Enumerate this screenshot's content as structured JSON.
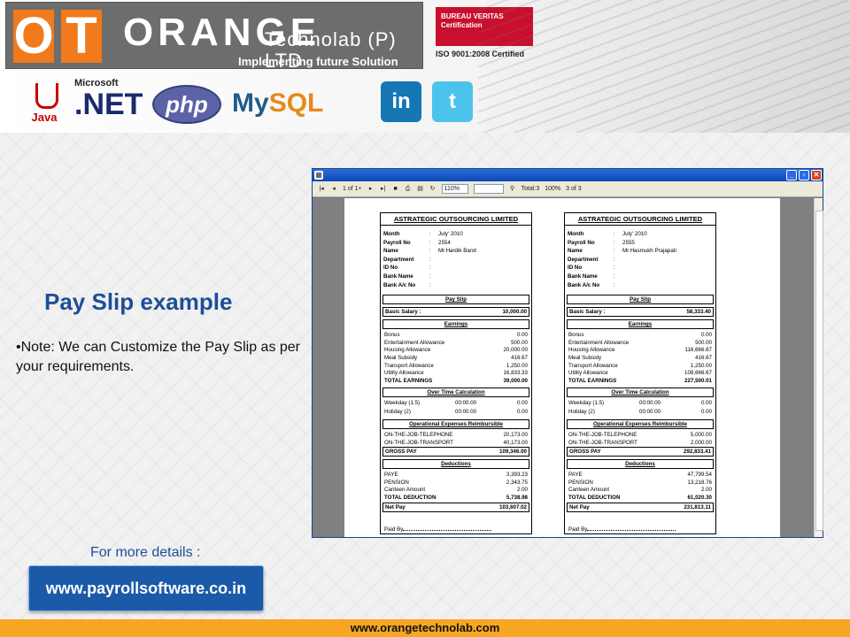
{
  "header": {
    "logo_o": "O",
    "logo_t": "T",
    "brand": "ORANGE",
    "brand_sub": "Technolab (P) LTD",
    "tagline": "Implementing future Solution",
    "cert_logo": "BUREAU VERITAS Certification",
    "cert_text": "ISO 9001:2008 Certified",
    "tech": {
      "java": "Java",
      "microsoft": "Microsoft",
      "net": ".NET",
      "php": "php",
      "mysql_a": "My",
      "mysql_b": "SQL"
    },
    "social": {
      "linkedin": "in",
      "twitter": "t"
    }
  },
  "slide": {
    "title": "Pay Slip example",
    "note": "•Note: We can Customize the Pay Slip as per your requirements.",
    "more_details": "For more details :",
    "url_button": "www.payrollsoftware.co.in",
    "footer": "www.orangetechnolab.com"
  },
  "viewer": {
    "page_of": "1 of 1+",
    "zoom": "110%",
    "total": "Total:3",
    "percent": "100%",
    "count": "3 of 3"
  },
  "slips": [
    {
      "company": "ASTRATEGIC OUTSOURCING LIMITED",
      "info": [
        {
          "k": "Month",
          "v": "July' 2010"
        },
        {
          "k": "Payroll No",
          "v": "2554"
        },
        {
          "k": "Name",
          "v": "Mr.Hardik Barot"
        },
        {
          "k": "Department",
          "v": ""
        },
        {
          "k": "ID No",
          "v": ""
        },
        {
          "k": "Bank Name",
          "v": ""
        },
        {
          "k": "Bank A/c No",
          "v": ""
        }
      ],
      "pay_slip_label": "Pay Slip",
      "basic_label": "Basic Salary",
      "basic_value": "10,000.00",
      "earnings_label": "Earnings",
      "earnings": [
        {
          "n": "Bonus",
          "v": "0.00"
        },
        {
          "n": "Entertainment Allowance",
          "v": "500.00"
        },
        {
          "n": "Housing Allowance",
          "v": "20,000.00"
        },
        {
          "n": "Meal Subsidy",
          "v": "416.67"
        },
        {
          "n": "Transport Allowance",
          "v": "1,250.00"
        },
        {
          "n": "Utility Allowance",
          "v": "16,833.33"
        }
      ],
      "total_earnings_label": "TOTAL EARNINGS",
      "total_earnings": "39,000.00",
      "ot_label": "Over Time Calculation",
      "ot": [
        {
          "n": "Weekday (1.5)",
          "t": "00:00:00",
          "v": "0.00"
        },
        {
          "n": "Holiday (2)",
          "t": "00:00:00",
          "v": "0.00"
        }
      ],
      "ope_label": "Operational Expenses Reimbursible",
      "ope": [
        {
          "n": "ON-THE-JOB-TELEPHONE",
          "v": "20,173.00"
        },
        {
          "n": "ON-THE-JOB-TRANSPORT",
          "v": "40,173.00"
        }
      ],
      "gross_label": "GROSS PAY",
      "gross": "109,346.00",
      "deductions_label": "Deductions",
      "deductions": [
        {
          "n": "PAYE",
          "v": "3,393.23"
        },
        {
          "n": "PENSION",
          "v": "2,343.75"
        },
        {
          "n": "Canteen Amount",
          "v": "2.00"
        }
      ],
      "total_deduction_label": "TOTAL DEDUCTION",
      "total_deduction": "5,738.98",
      "net_label": "Net Pay",
      "net": "103,607.02",
      "paid_by": "Paid By"
    },
    {
      "company": "ASTRATEGIC OUTSOURCING LIMITED",
      "info": [
        {
          "k": "Month",
          "v": "July' 2010"
        },
        {
          "k": "Payroll No",
          "v": "2555"
        },
        {
          "k": "Name",
          "v": "Mr.Hasmukh Prajapati"
        },
        {
          "k": "Department",
          "v": ""
        },
        {
          "k": "ID No",
          "v": ""
        },
        {
          "k": "Bank Name",
          "v": ""
        },
        {
          "k": "Bank A/c No",
          "v": ""
        }
      ],
      "pay_slip_label": "Pay Slip",
      "basic_label": "Basic Salary",
      "basic_value": "58,333.40",
      "earnings_label": "Earnings",
      "earnings": [
        {
          "n": "Bonus",
          "v": "0.00"
        },
        {
          "n": "Entertainment Allowance",
          "v": "500.00"
        },
        {
          "n": "Housing Allowance",
          "v": "116,666.67"
        },
        {
          "n": "Meal Subsidy",
          "v": "416.67"
        },
        {
          "n": "Transport Allowance",
          "v": "1,250.00"
        },
        {
          "n": "Utility Allowance",
          "v": "108,666.67"
        }
      ],
      "total_earnings_label": "TOTAL EARNINGS",
      "total_earnings": "227,500.01",
      "ot_label": "Over Time Calculation",
      "ot": [
        {
          "n": "Weekday (1.5)",
          "t": "00:00:00",
          "v": "0.00"
        },
        {
          "n": "Holiday (2)",
          "t": "00:00:00",
          "v": "0.00"
        }
      ],
      "ope_label": "Operational Expenses Reimbursible",
      "ope": [
        {
          "n": "ON-THE-JOB-TELEPHONE",
          "v": "5,000.00"
        },
        {
          "n": "ON-THE-JOB-TRANSPORT",
          "v": "2,000.00"
        }
      ],
      "gross_label": "GROSS PAY",
      "gross": "292,833.41",
      "deductions_label": "Deductions",
      "deductions": [
        {
          "n": "PAYE",
          "v": "47,799.54"
        },
        {
          "n": "PENSION",
          "v": "13,218.76"
        },
        {
          "n": "Canteen Amount",
          "v": "2.00"
        }
      ],
      "total_deduction_label": "TOTAL DEDUCTION",
      "total_deduction": "61,020.30",
      "net_label": "Net Pay",
      "net": "231,813.11",
      "paid_by": "Paid By"
    }
  ]
}
